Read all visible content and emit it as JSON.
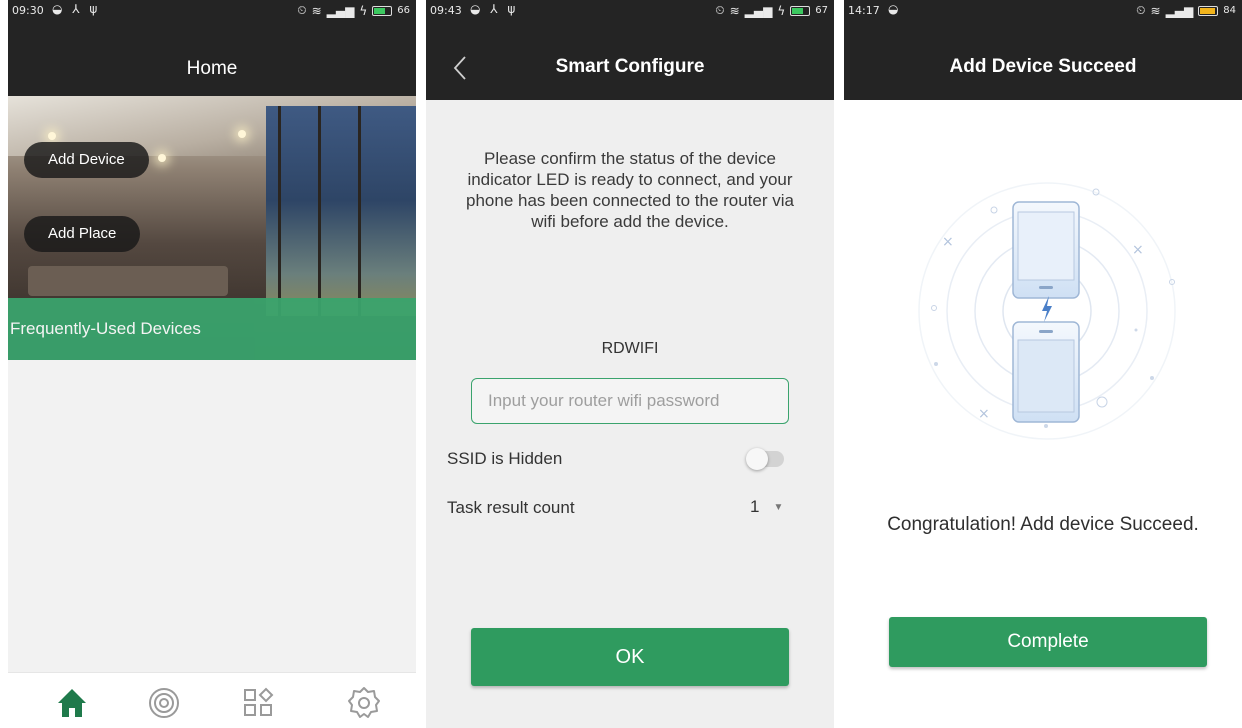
{
  "accent_color": "#2f9b5f",
  "screens": {
    "home": {
      "status": {
        "time": "09:30",
        "battery": "66"
      },
      "title": "Home",
      "add_device": "Add Device",
      "add_place": "Add Place",
      "frequently_used": "Frequently-Used Devices",
      "nav": [
        "home-icon",
        "scan-icon",
        "grid-icon",
        "gear-icon"
      ]
    },
    "smart_configure": {
      "status": {
        "time": "09:43",
        "battery": "67"
      },
      "title": "Smart Configure",
      "instructions": "Please confirm the status of the device indicator LED is ready to connect, and your phone has been connected to the router via wifi before add the device.",
      "ssid": "RDWIFI",
      "password_placeholder": "Input your router wifi password",
      "ssid_hidden_label": "SSID is Hidden",
      "task_count_label": "Task result count",
      "task_count_value": "1",
      "ok_label": "OK"
    },
    "success": {
      "status": {
        "time": "14:17",
        "battery": "84"
      },
      "title": "Add Device Succeed",
      "message": "Congratulation! Add device Succeed.",
      "complete_label": "Complete"
    }
  }
}
